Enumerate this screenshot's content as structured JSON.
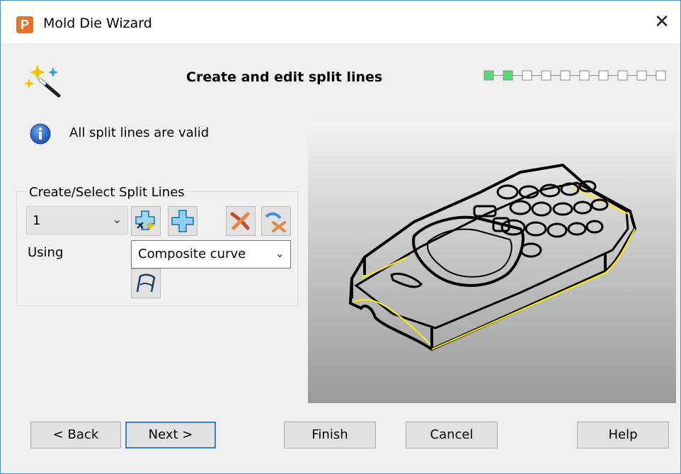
{
  "window": {
    "app_icon_letter": "P",
    "title": "Mold Die Wizard",
    "close_glyph": "✕"
  },
  "header": {
    "page_title": "Create and edit split lines",
    "progress_steps_total": 10,
    "progress_steps_done": 2,
    "progress_done_color": "#5ad87a"
  },
  "status": {
    "icon": "info-icon",
    "text": "All split lines are valid"
  },
  "split_lines": {
    "group_label": "Create/Select Split Lines",
    "selected_value": "1",
    "using_label": "Using",
    "using_value": "Composite curve",
    "buttons": [
      "new-split-line-icon",
      "add-split-line-icon",
      "delete-split-line-icon",
      "delete-all-split-lines-icon"
    ],
    "curve_button_icon": "composite-curve-icon"
  },
  "preview": {
    "description_icon": "phone-model-preview",
    "highlight_color": "#ffee00"
  },
  "footer": {
    "back_label": "< Back",
    "next_label": "Next >",
    "finish_label": "Finish",
    "cancel_label": "Cancel",
    "help_label": "Help"
  }
}
